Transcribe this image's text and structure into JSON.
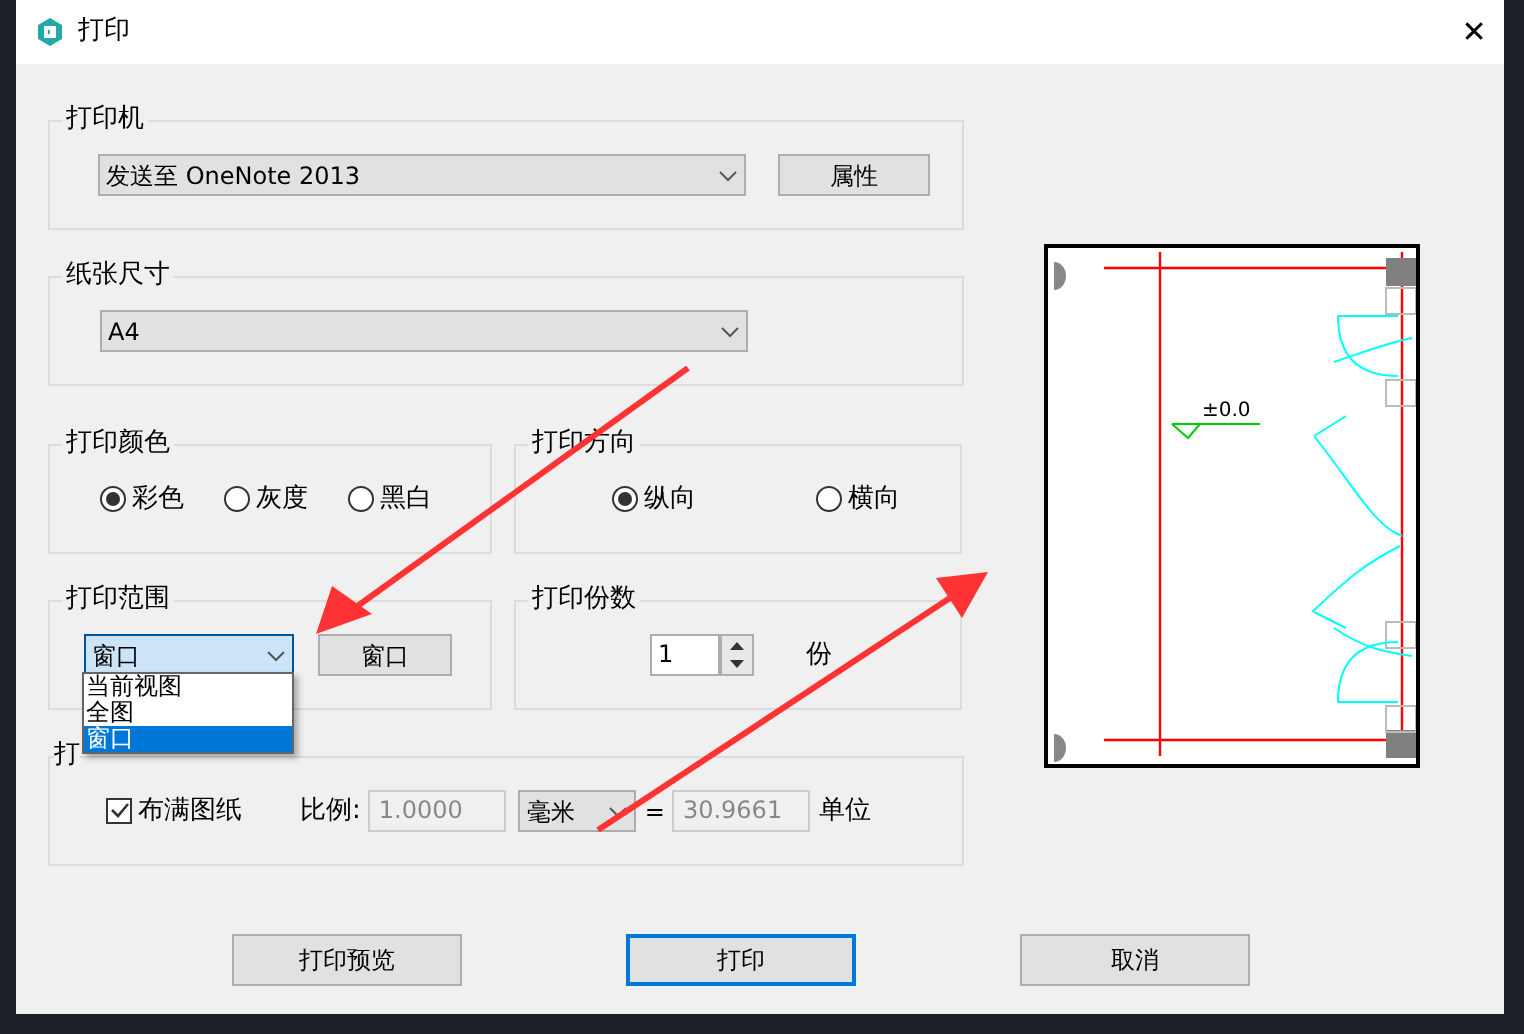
{
  "window": {
    "title": "打印",
    "close": "✕"
  },
  "printer": {
    "legend": "打印机",
    "value": "发送至 OneNote 2013",
    "button": "属性"
  },
  "paper": {
    "legend": "纸张尺寸",
    "value": "A4"
  },
  "color": {
    "legend": "打印颜色",
    "options": [
      {
        "label": "彩色",
        "selected": true
      },
      {
        "label": "灰度",
        "selected": false
      },
      {
        "label": "黑白",
        "selected": false
      }
    ]
  },
  "orientation": {
    "legend": "打印方向",
    "options": [
      {
        "label": "纵向",
        "selected": true
      },
      {
        "label": "横向",
        "selected": false
      }
    ]
  },
  "range": {
    "legend": "打印范围",
    "value": "窗口",
    "button": "窗口",
    "dropdown_open": true,
    "options": [
      {
        "label": "当前视图",
        "selected": false
      },
      {
        "label": "全图",
        "selected": false
      },
      {
        "label": "窗口",
        "selected": true
      }
    ]
  },
  "copies": {
    "legend": "打印份数",
    "value": "1",
    "unit": "份"
  },
  "scale": {
    "legend": "打",
    "fit_label": "布满图纸",
    "fit_checked": true,
    "ratio_label": "比例:",
    "ratio": "1.0000",
    "unit": "毫米",
    "equals": "=",
    "units_value": "30.9661",
    "units_label": "单位"
  },
  "preview": {
    "elevation": "±0.0"
  },
  "buttons": [
    {
      "label": "打印预览",
      "default": false
    },
    {
      "label": "打印",
      "default": true
    },
    {
      "label": "取消",
      "default": false
    }
  ]
}
